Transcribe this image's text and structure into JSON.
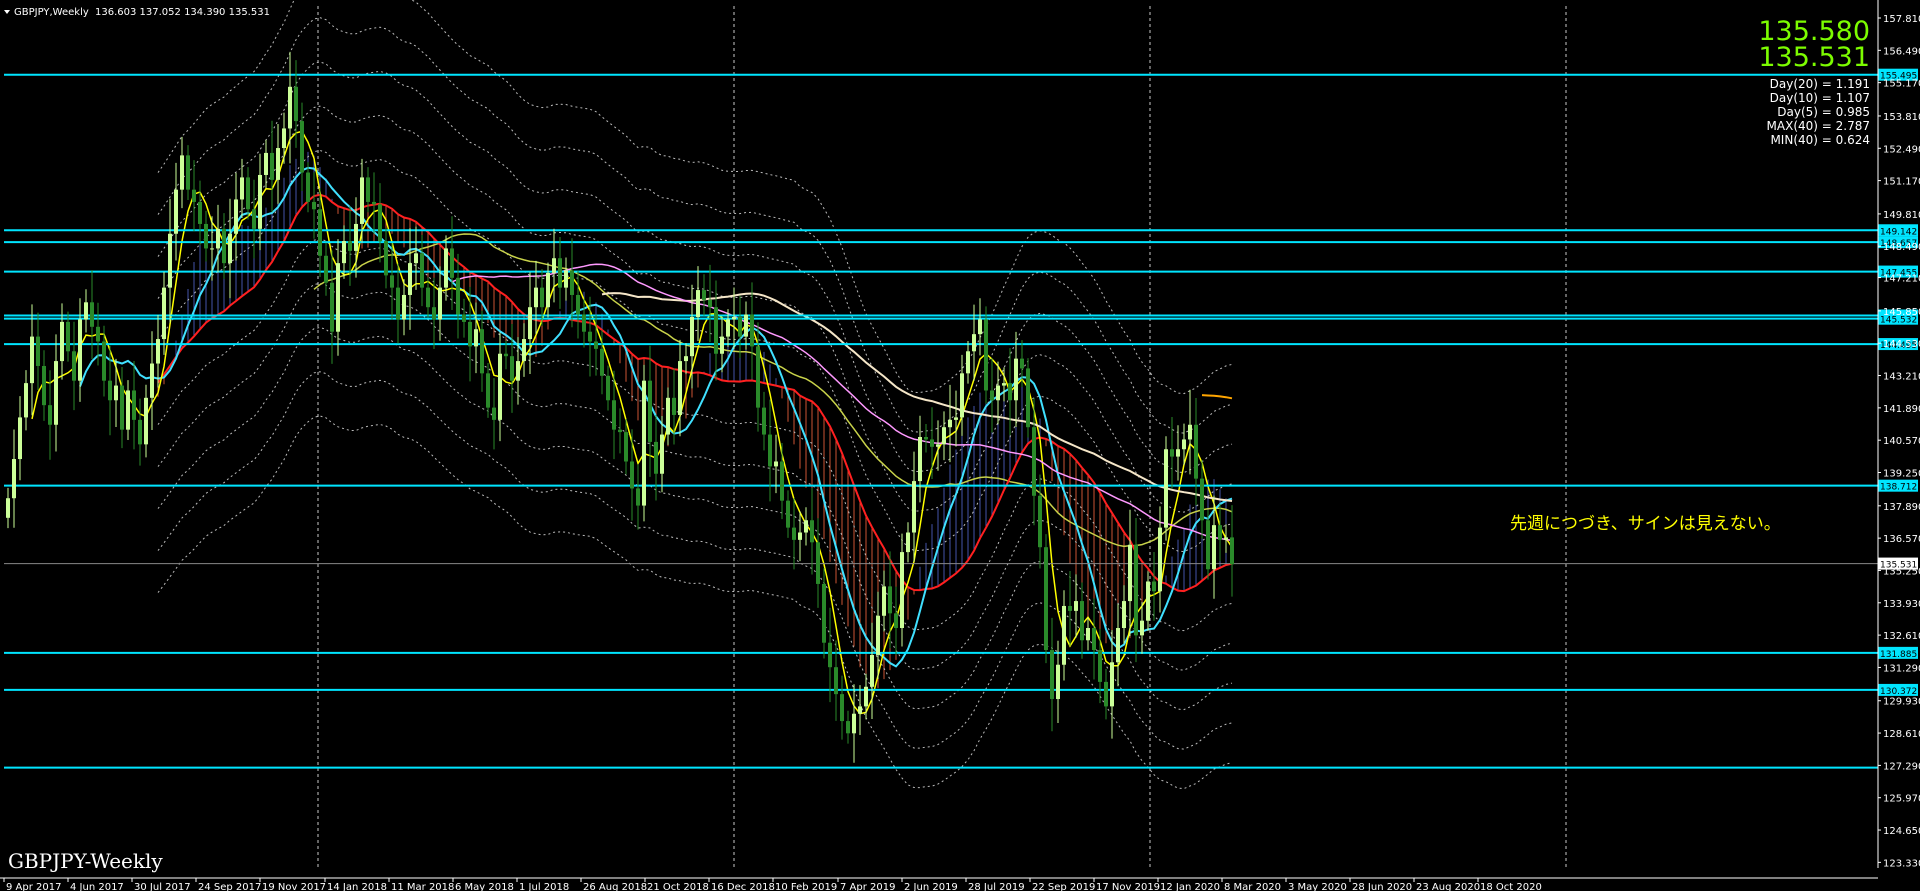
{
  "header": {
    "symbol": "GBPJPY,Weekly",
    "ohlc": "136.603 137.052 134.390 135.531"
  },
  "watermark": "GBPJPY-Weekly",
  "note": "先週につづき、サインは見えない。",
  "price_box": {
    "bid": "135.580",
    "ask": "135.531"
  },
  "stats": [
    "Day(20) = 1.191",
    "Day(10) = 1.107",
    "Day(5) = 0.985",
    "MAX(40) = 2.787",
    "MIN(40) = 0.624"
  ],
  "colors": {
    "background": "#000000",
    "bull_candle": "#ccff99",
    "bear_candle": "#2a8a2a",
    "level_line": "#00e5ff",
    "sma_red": "#ff2020",
    "sma_yellow": "#ffff00",
    "sma_cyan": "#40e0ff",
    "sma_olive": "#c8d24a",
    "sma_orange": "#ffa500",
    "sma_white": "#f5e6c8",
    "sma_violet": "#ff99ff",
    "bull_cloud": "#4455aa",
    "bear_cloud": "#cc5533"
  },
  "chart_data": {
    "type": "candlestick",
    "title": "GBPJPY,Weekly",
    "ylim": [
      123.1,
      158.3
    ],
    "y_ticks": [
      "157.810",
      "156.490",
      "155.170",
      "153.810",
      "152.490",
      "151.170",
      "149.810",
      "148.490",
      "147.210",
      "145.850",
      "144.530",
      "143.210",
      "141.890",
      "140.570",
      "139.250",
      "137.890",
      "136.570",
      "135.250",
      "133.930",
      "132.610",
      "131.290",
      "129.930",
      "128.610",
      "127.290",
      "125.970",
      "124.650",
      "123.330"
    ],
    "x_labels": [
      "9 Apr 2017",
      "4 Jun 2017",
      "30 Jul 2017",
      "24 Sep 2017",
      "19 Nov 2017",
      "14 Jan 2018",
      "11 Mar 2018",
      "6 May 2018",
      "1 Jul 2018",
      "26 Aug 2018",
      "21 Oct 2018",
      "16 Dec 2018",
      "10 Feb 2019",
      "7 Apr 2019",
      "2 Jun 2019",
      "28 Jul 2019",
      "22 Sep 2019",
      "17 Nov 2019",
      "12 Jan 2020",
      "8 Mar 2020",
      "3 May 2020",
      "28 Jun 2020",
      "23 Aug 2020",
      "18 Oct 2020"
    ],
    "levels": [
      {
        "value": 155.495,
        "label": "155.495"
      },
      {
        "value": 149.142,
        "label": "149.142"
      },
      {
        "value": 148.657,
        "label": "148.657"
      },
      {
        "value": 147.455,
        "label": "147.455"
      },
      {
        "value": 145.662,
        "label": "145.662"
      },
      {
        "value": 145.532,
        "label": "145.532"
      },
      {
        "value": 144.495,
        "label": "144.495"
      },
      {
        "value": 138.712,
        "label": "138.712"
      },
      {
        "value": 131.885,
        "label": "131.885"
      },
      {
        "value": 130.372,
        "label": "130.372"
      },
      {
        "value": 127.2,
        "label": ""
      }
    ],
    "current_price": {
      "value": 135.531,
      "label": "135.531"
    },
    "closes": [
      138.2,
      139.8,
      141.5,
      142.9,
      144.8,
      143.6,
      142.0,
      141.2,
      143.8,
      145.4,
      144.2,
      143.0,
      145.5,
      146.2,
      145.2,
      144.6,
      143.0,
      142.2,
      142.8,
      141.0,
      142.6,
      141.4,
      140.4,
      142.3,
      143.7,
      144.7,
      146.8,
      149.0,
      150.8,
      152.2,
      150.8,
      150.3,
      149.4,
      148.4,
      148.4,
      149.2,
      147.8,
      149.0,
      150.4,
      151.3,
      150.0,
      149.2,
      151.4,
      152.3,
      151.2,
      152.5,
      153.3,
      155.0,
      153.6,
      151.5,
      150.3,
      150.0,
      148.1,
      147.0,
      145.0,
      147.8,
      148.7,
      148.3,
      149.4,
      151.3,
      150.3,
      150.2,
      148.7,
      147.3,
      146.8,
      145.5,
      146.5,
      147.8,
      148.2,
      146.8,
      146.0,
      145.5,
      146.8,
      148.4,
      147.2,
      145.7,
      145.4,
      144.4,
      145.1,
      143.3,
      141.9,
      141.4,
      144.1,
      144.0,
      143.0,
      143.8,
      144.7,
      146.0,
      146.8,
      146.0,
      147.4,
      148.0,
      146.8,
      147.5,
      146.5,
      145.7,
      145.0,
      144.6,
      144.3,
      143.2,
      142.2,
      141.0,
      140.9,
      139.7,
      138.6,
      137.9,
      143.0,
      140.5,
      139.2,
      140.8,
      142.3,
      141.6,
      143.8,
      144.0,
      145.6,
      146.7,
      146.3,
      146.0,
      144.1,
      144.8,
      145.5,
      145.6,
      144.8,
      145.7,
      144.4,
      141.9,
      140.8,
      139.5,
      139.7,
      138.1,
      137.0,
      136.5,
      136.8,
      137.3,
      136.4,
      134.7,
      132.3,
      131.3,
      130.2,
      129.1,
      128.6,
      129.4,
      129.7,
      130.5,
      131.8,
      133.4,
      134.6,
      133.5,
      132.9,
      136.0,
      136.8,
      138.9,
      140.7,
      140.6,
      140.3,
      140.4,
      141.1,
      141.4,
      141.5,
      143.3,
      144.2,
      144.9,
      145.5,
      142.6,
      142.2,
      142.8,
      142.9,
      142.2,
      143.9,
      143.5,
      141.1,
      138.3,
      136.2,
      132.0,
      130.0,
      131.4,
      133.8,
      133.6,
      134.0,
      132.4,
      132.9,
      132.0,
      130.7,
      129.7,
      131.5,
      132.9,
      134.0,
      136.3,
      132.6,
      133.2,
      134.8,
      134.4,
      137.0,
      140.2,
      139.9,
      140.2,
      140.6,
      141.2,
      139.0,
      137.3,
      135.3,
      137.1,
      136.5,
      136.6,
      135.5
    ],
    "series": [
      {
        "name": "",
        "color": "#ff2020"
      },
      {
        "name": "",
        "color": "#ffff00"
      },
      {
        "name": "",
        "color": "#40e0ff"
      }
    ]
  }
}
